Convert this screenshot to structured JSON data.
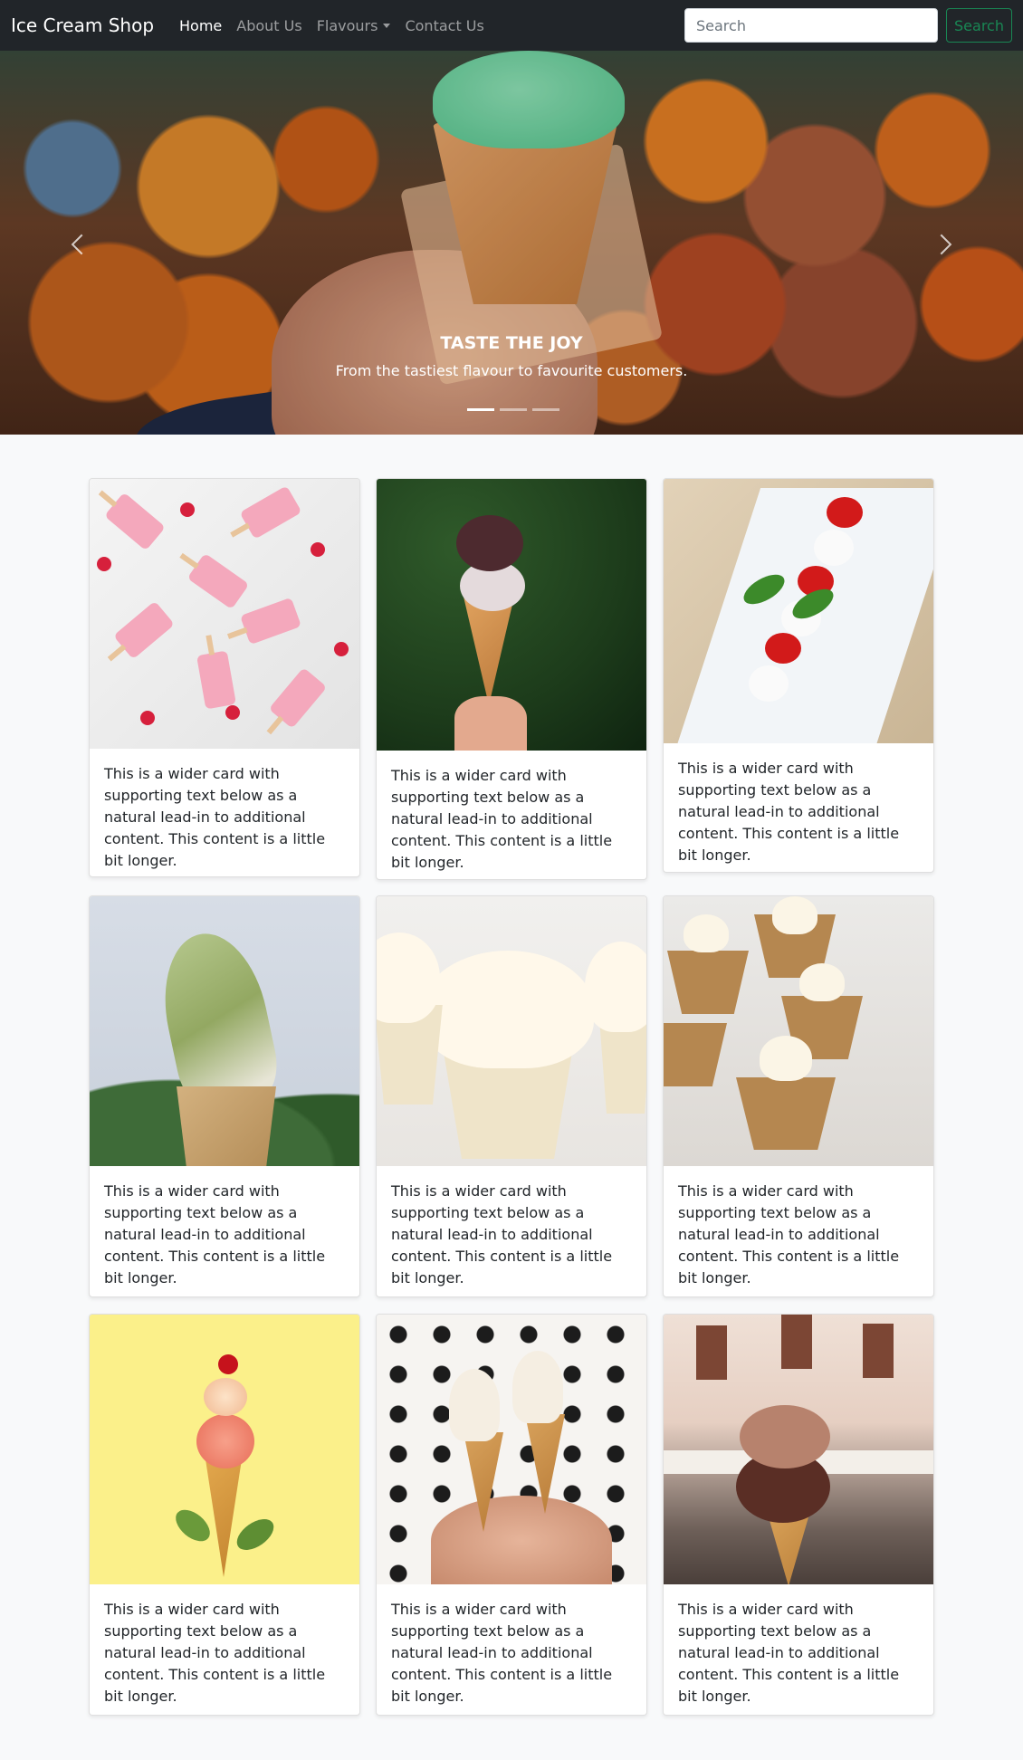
{
  "navbar": {
    "brand": "Ice Cream Shop",
    "links": [
      {
        "label": "Home",
        "active": true
      },
      {
        "label": "About Us",
        "active": false
      },
      {
        "label": "Flavours",
        "active": false,
        "dropdown": true
      },
      {
        "label": "Contact Us",
        "active": false
      }
    ],
    "search": {
      "placeholder": "Search",
      "button_label": "Search"
    }
  },
  "carousel": {
    "caption_title": "TASTE THE JOY",
    "caption_text": "From the tastiest flavour to favourite customers.",
    "indicator_count": 3,
    "active_index": 0,
    "prev_icon": "chevron-left-icon",
    "next_icon": "chevron-right-icon"
  },
  "cards": [
    {
      "text": "This is a wider card with supporting text below as a natural lead-in to additional content. This content is a little bit longer."
    },
    {
      "text": "This is a wider card with supporting text below as a natural lead-in to additional content. This content is a little bit longer."
    },
    {
      "text": "This is a wider card with supporting text below as a natural lead-in to additional content. This content is a little bit longer."
    },
    {
      "text": "This is a wider card with supporting text below as a natural lead-in to additional content. This content is a little bit longer."
    },
    {
      "text": "This is a wider card with supporting text below as a natural lead-in to additional content. This content is a little bit longer."
    },
    {
      "text": "This is a wider card with supporting text below as a natural lead-in to additional content. This content is a little bit longer."
    },
    {
      "text": "This is a wider card with supporting text below as a natural lead-in to additional content. This content is a little bit longer."
    },
    {
      "text": "This is a wider card with supporting text below as a natural lead-in to additional content. This content is a little bit longer."
    },
    {
      "text": "This is a wider card with supporting text below as a natural lead-in to additional content. This content is a little bit longer."
    }
  ],
  "colors": {
    "navbar_bg": "#212529",
    "page_bg": "#f8f9fa",
    "search_button": "#198754"
  }
}
